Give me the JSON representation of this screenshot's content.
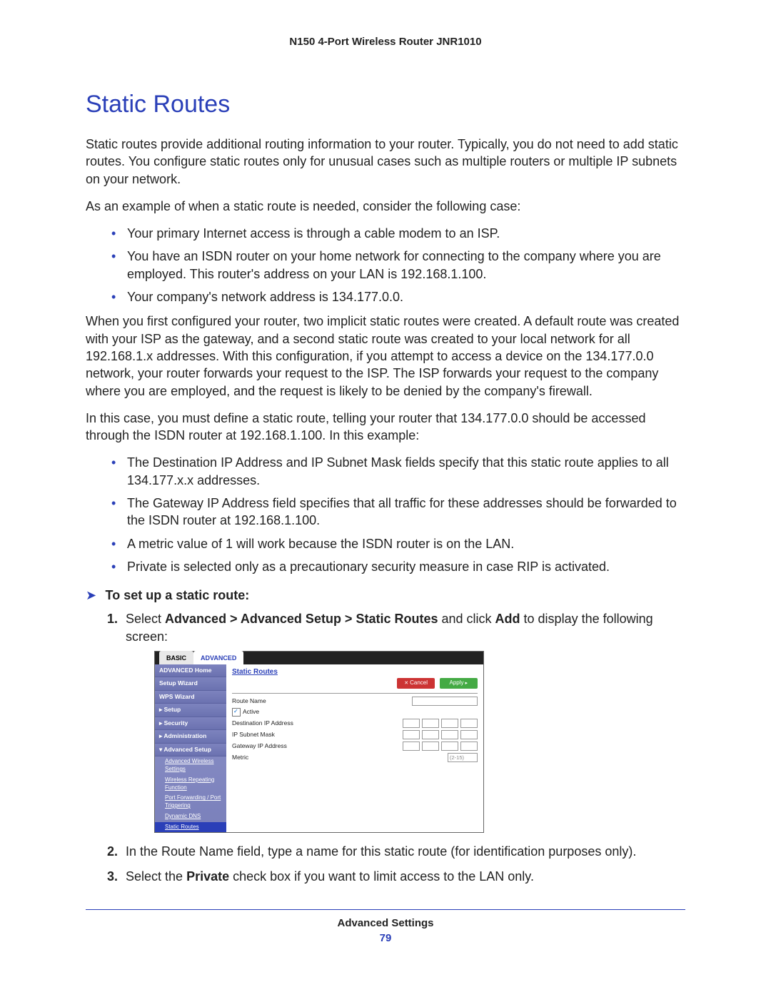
{
  "doc_header": "N150 4-Port Wireless Router JNR1010",
  "section_title": "Static Routes",
  "para1": "Static routes provide additional routing information to your router. Typically, you do not need to add static routes. You configure static routes only for unusual cases such as multiple routers or multiple IP subnets on your network.",
  "para2": "As an example of when a static route is needed, consider the following case:",
  "list1": [
    "Your primary Internet access is through a cable modem to an ISP.",
    "You have an ISDN router on your home network for connecting to the company where you are employed. This router's address on your LAN is 192.168.1.100.",
    "Your company's network address is 134.177.0.0."
  ],
  "para3": "When you first configured your router, two implicit static routes were created. A default route was created with your ISP as the gateway, and a second static route was created to your local network for all 192.168.1.x addresses. With this configuration, if you attempt to access a device on the 134.177.0.0 network, your router forwards your request to the ISP. The ISP forwards your request to the company where you are employed, and the request is likely to be denied by the company's firewall.",
  "para4": "In this case, you must define a static route, telling your router that 134.177.0.0 should be accessed through the ISDN router at 192.168.1.100. In this example:",
  "list2": [
    "The Destination IP Address and IP Subnet Mask fields specify that this static route applies to all 134.177.x.x addresses.",
    "The Gateway IP Address field specifies that all traffic for these addresses should be forwarded to the ISDN router at 192.168.1.100.",
    "A metric value of 1 will work because the ISDN router is on the LAN.",
    "Private is selected only as a precautionary security measure in case RIP is activated."
  ],
  "task_title": "To set up a static route:",
  "step1_pre": "Select ",
  "step1_b1": "Advanced > Advanced Setup > Static Routes",
  "step1_mid": " and click ",
  "step1_b2": "Add",
  "step1_post": " to display the following screen:",
  "step2": "In the Route Name field, type a name for this static route (for identification purposes only).",
  "step3_pre": "Select the ",
  "step3_b": "Private",
  "step3_post": " check box if you want to limit access to the LAN only.",
  "router": {
    "tab_basic": "BASIC",
    "tab_adv": "ADVANCED",
    "nav": {
      "home": "ADVANCED Home",
      "setup_wizard": "Setup Wizard",
      "wps": "WPS Wizard",
      "setup": "▸ Setup",
      "security": "▸ Security",
      "admin": "▸ Administration",
      "adv_setup": "▾ Advanced Setup",
      "sub_aw": "Advanced Wireless Settings",
      "sub_wr": "Wireless Repeating Function",
      "sub_pf": "Port Forwarding / Port Triggering",
      "sub_ddns": "Dynamic DNS",
      "sub_sr": "Static Routes"
    },
    "content": {
      "title": "Static Routes",
      "cancel": "Cancel",
      "apply": "Apply",
      "route_name": "Route Name",
      "active": "Active",
      "dest_ip": "Destination IP Address",
      "subnet": "IP Subnet Mask",
      "gateway": "Gateway IP Address",
      "metric": "Metric",
      "metric_hint": "(2-15)"
    }
  },
  "footer_section": "Advanced Settings",
  "footer_page": "79"
}
